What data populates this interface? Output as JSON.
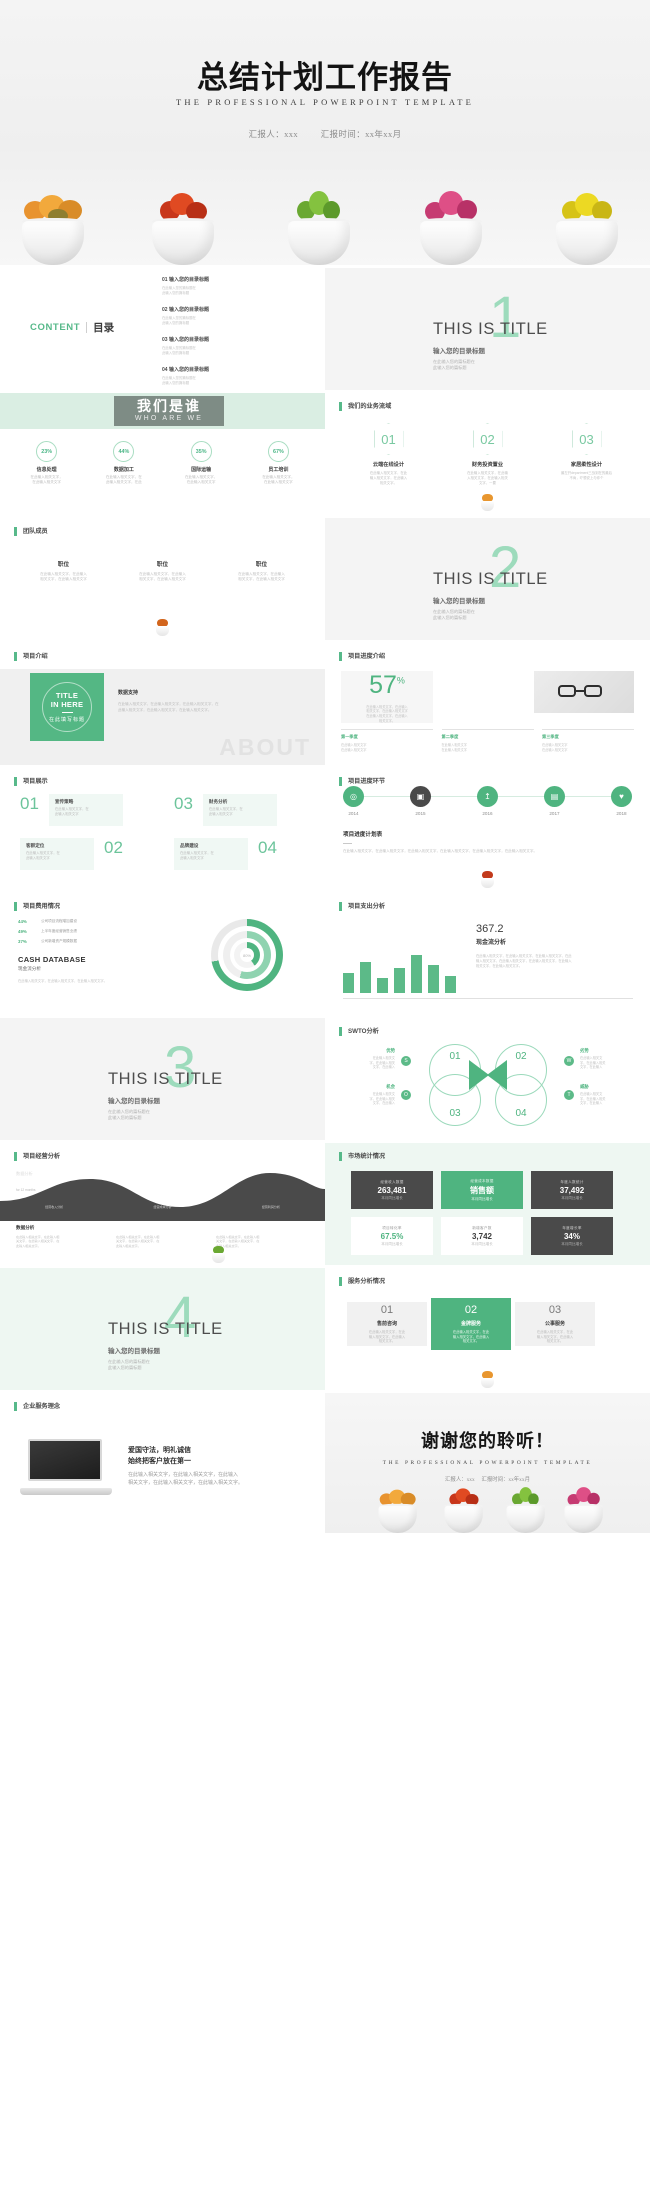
{
  "cover": {
    "title": "总结计划工作报告",
    "subtitle": "THE PROFESSIONAL POWERPOINT TEMPLATE",
    "reporter": "汇报人：xxx",
    "report_time": "汇报时间：xx年xx月"
  },
  "colors": {
    "accent_green": "#54b784",
    "light_green": "#9ddbbc",
    "pale_green": "#eef7f2",
    "band_green": "#daeee3",
    "dark_gray": "#7e8c85",
    "text_dark": "#3c3c3c",
    "text_muted": "#bdbdbd"
  },
  "toc": {
    "label_en": "CONTENT",
    "label_cn": "目录",
    "items": [
      {
        "num": "01",
        "title": "输入您的目录标题",
        "body": "在此输入您的篇标题在\n此输入您的篇标题"
      },
      {
        "num": "02",
        "title": "输入您的目录标题",
        "body": "在此输入您的篇标题在\n此输入您的篇标题"
      },
      {
        "num": "03",
        "title": "输入您的目录标题",
        "body": "在此输入您的篇标题在\n此输入您的篇标题"
      },
      {
        "num": "04",
        "title": "输入您的目录标题",
        "body": "在此输入您的篇标题在\n此输入您的篇标题"
      }
    ]
  },
  "sections": [
    {
      "number": "1",
      "title_en": "THIS IS TITLE",
      "title_cn": "输入您的目录标题",
      "body": "在此输入您的篇标题在\n此输入您的篇标题"
    },
    {
      "number": "2",
      "title_en": "THIS IS TITLE",
      "title_cn": "输入您的目录标题",
      "body": "在此输入您的篇标题在\n此输入您的篇标题"
    },
    {
      "number": "3",
      "title_en": "THIS IS TITLE",
      "title_cn": "输入您的目录标题",
      "body": "在此输入您的篇标题在\n此输入您的篇标题"
    },
    {
      "number": "4",
      "title_en": "THIS IS TITLE",
      "title_cn": "输入您的目录标题",
      "body": "在此输入您的篇标题在\n此输入您的篇标题"
    }
  ],
  "who_are_we": {
    "heading_cn": "我们是谁",
    "heading_en": "WHO ARE WE",
    "stats": [
      {
        "pct": "23%",
        "label": "信息处理",
        "body": "在此输入相关文字，\n在此输入相关文字"
      },
      {
        "pct": "44%",
        "label": "数据加工",
        "body": "在此输入相关文字，在\n此输入相关文字，在此"
      },
      {
        "pct": "35%",
        "label": "国际运输",
        "body": "在此输入相关文字，\n在此输入相关文字"
      },
      {
        "pct": "67%",
        "label": "员工培训",
        "body": "在此输入相关文字，\n在此输入相关文字"
      }
    ]
  },
  "business_flow": {
    "section_title": "我们的业务流域",
    "steps": [
      {
        "num": "01",
        "label": "云端在线设计",
        "body": "在此输入相关文字，在此\n输入相关文字，在此输入\n相关文字。"
      },
      {
        "num": "02",
        "label": "财务投资置业",
        "body": "在此输入相关文字，在此输\n入相关文字，在此输入相关\n文字，一要"
      },
      {
        "num": "03",
        "label": "家居柔性设计",
        "body": "最左开department三战到在的最后\n不肯，吓想说上与你个"
      }
    ]
  },
  "team": {
    "section_title": "团队成员",
    "members": [
      {
        "role": "职位",
        "body": "在此输入相关文字，在此输入\n相关文字，在此输入相关文字"
      },
      {
        "role": "职位",
        "body": "在此输入相关文字，在此输入\n相关文字，在此输入相关文字"
      },
      {
        "role": "职位",
        "body": "在此输入相关文字，在此输入\n相关文字，在此输入相关文字"
      }
    ]
  },
  "project_intro": {
    "section_title": "项目介绍",
    "badge_line1": "TITLE",
    "badge_line2": "IN HERE",
    "badge_cn": "在此填写标题",
    "body_title": "数据支持",
    "body_text": "在此输入相关文字，在此输入相关文字，在此输入相关文字，在\n此输入相关文字，在此输入相关文字，在此输入相关文字。",
    "watermark": "ABOUT"
  },
  "progress_intro": {
    "section_title": "项目进度介绍",
    "percent": "57",
    "percent_unit": "%",
    "body": "在此输入相关文字，在此输入\n相关文字，在此输入相关文字\n在此输入相关文字，在此输入\n相关文字。",
    "quarters": [
      {
        "label": "第一季度",
        "body": "在此输入相关文字\n在此输入相关文字"
      },
      {
        "label": "第二季度",
        "body": "在此输入相关文字\n在此输入相关文字"
      },
      {
        "label": "第三季度",
        "body": "在此输入相关文字\n在此输入相关文字"
      }
    ]
  },
  "showcase": {
    "section_title": "项目展示",
    "cells": [
      {
        "num": "01",
        "title": "宣传策略",
        "body": "在此输入相关文字，在\n此输入相关文字"
      },
      {
        "num": "03",
        "title": "财务分析",
        "body": "在此输入相关文字，在\n此输入相关文字"
      },
      {
        "num": "02",
        "title": "客群定位",
        "body": "在此输入相关文字，在\n此输入相关文字"
      },
      {
        "num": "04",
        "title": "品牌建设",
        "body": "在此输入相关文字，在\n此输入相关文字"
      }
    ]
  },
  "timeline": {
    "section_title": "项目进度环节",
    "years": [
      "2014",
      "2015",
      "2016",
      "2017",
      "2018"
    ],
    "plan_title": "项目进度计划表",
    "plan_body": "在此输入相关文字，在此输入相关文字，在此输入相关文字，在此输入相关文字，在此输入相关文字，在此输入相关文字。"
  },
  "cost": {
    "section_title": "项目费用情况",
    "rows": [
      {
        "pct": "44%",
        "label": "公司项目流程增加建设"
      },
      {
        "pct": "49%",
        "label": "上半年度经营销售业绩"
      },
      {
        "pct": "37%",
        "label": "公司新增资产规模数据"
      }
    ],
    "db_title": "CASH DATABASE",
    "db_sub": "现金流分析",
    "db_body": "在此输入相关文字，在此输入相关文字，在此输入相关文字。",
    "donut_label": "80%"
  },
  "expense": {
    "section_title": "项目支出分析",
    "value": "367.2",
    "value_label": "现金流分析",
    "body": "在此输入相关文字，在此输入相关文字，在此输入相关文字，在此\n输入相关文字，在此输入相关文字，在此输入相关文字，在此输入\n相关文字，在此输入相关文字。",
    "bars": [
      52,
      78,
      38,
      64,
      96,
      70,
      44
    ]
  },
  "swot": {
    "section_title": "SWTO分析",
    "items": [
      {
        "key": "S",
        "num": "01",
        "label": "优势",
        "body": "在此输入相关文\n字，在此输入相关\n文字，在此输入"
      },
      {
        "key": "W",
        "num": "02",
        "label": "劣势",
        "body": "在此输入相关文\n字，在此输入相关\n文字，在此输入"
      },
      {
        "key": "O",
        "num": "03",
        "label": "机会",
        "body": "在此输入相关文\n字，在此输入相关\n文字，在此输入"
      },
      {
        "key": "T",
        "num": "04",
        "label": "威胁",
        "body": "在此输入相关文\n字，在此输入相关\n文字，在此输入"
      }
    ]
  },
  "wave": {
    "section_title": "项目经营分析",
    "data_title": "数据分析",
    "data_value": "2,163,372",
    "data_sub": "for 12 months",
    "axis_labels": [
      "经营收入分析",
      "经营成本分析",
      "经营利润分析"
    ],
    "detail_title": "数据分析",
    "detail_cols": [
      "在此输入相关文字，在此输入相\n关文字，在此输入相关文字，在\n此输入相关文字。",
      "在此输入相关文字，在此输入相\n关文字，在此输入相关文字，在\n此输入相关文字。",
      "在此输入相关文字，在此输入相\n关文字，在此输入相关文字，在\n此输入相关文字。"
    ]
  },
  "market": {
    "section_title": "市场统计情况",
    "cards": [
      {
        "title": "经营收入数据",
        "value": "263,481",
        "change": "本月同比增长"
      },
      {
        "title": "经营成本数据",
        "value": "销售额",
        "change": "本月同比增长"
      },
      {
        "title": "年度人数统计",
        "value": "37,492",
        "change": "本月同比增长"
      },
      {
        "title": "项目转化率",
        "value": "67.5%",
        "change": "本月同比增长"
      },
      {
        "title": "新增客户数",
        "value": "3,742",
        "change": "本月同比增长"
      },
      {
        "title": "年度增长率",
        "value": "34%",
        "change": "本月同比增长"
      }
    ]
  },
  "service_analysis": {
    "section_title": "服务分析情况",
    "cards": [
      {
        "num": "01",
        "label": "售前咨询",
        "body": "在此输入相关文字，在此\n输入相关文字，在此输入\n相关文字。"
      },
      {
        "num": "02",
        "label": "金牌服务",
        "body": "在此输入相关文字，在此\n输入相关文字，在此输入\n相关文字。"
      },
      {
        "num": "03",
        "label": "公事服务",
        "body": "在此输入相关文字，在此\n输入相关文字，在此输入\n相关文字。"
      }
    ]
  },
  "culture": {
    "section_title": "企业服务理念",
    "line1": "爱国守法，明礼诚信",
    "line2": "始终把客户放在第一",
    "body": "在此输入相关文字，在此输入相关文字，在此输入\n相关文字，在此输入相关文字，在此输入相关文字。"
  },
  "thanks": {
    "title": "谢谢您的聆听！",
    "subtitle": "THE PROFESSIONAL POWERPOINT TEMPLATE",
    "reporter": "汇报人：xxx",
    "report_time": "汇报时间：xx年xx月"
  }
}
